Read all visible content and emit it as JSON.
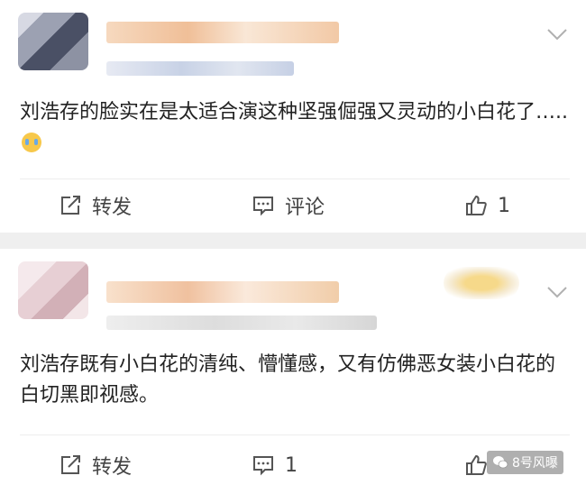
{
  "posts": [
    {
      "text": "刘浩存的脸实在是太适合演这种坚强倔强又灵动的小白花了…..",
      "emoji_icon": "crying-face-icon",
      "actions": {
        "repost_label": "转发",
        "comment_label": "评论",
        "like_count": "1"
      }
    },
    {
      "text": "刘浩存既有小白花的清纯、懵懂感，又有仿佛恶女装小白花的白切黑即视感。",
      "actions": {
        "repost_label": "转发",
        "comment_count": "1",
        "like_count": ""
      }
    }
  ],
  "watermark": {
    "text": "8号风曝",
    "icon": "wechat-icon"
  },
  "colors": {
    "separator": "#efefef",
    "text": "#222222",
    "action_text": "#444444"
  }
}
